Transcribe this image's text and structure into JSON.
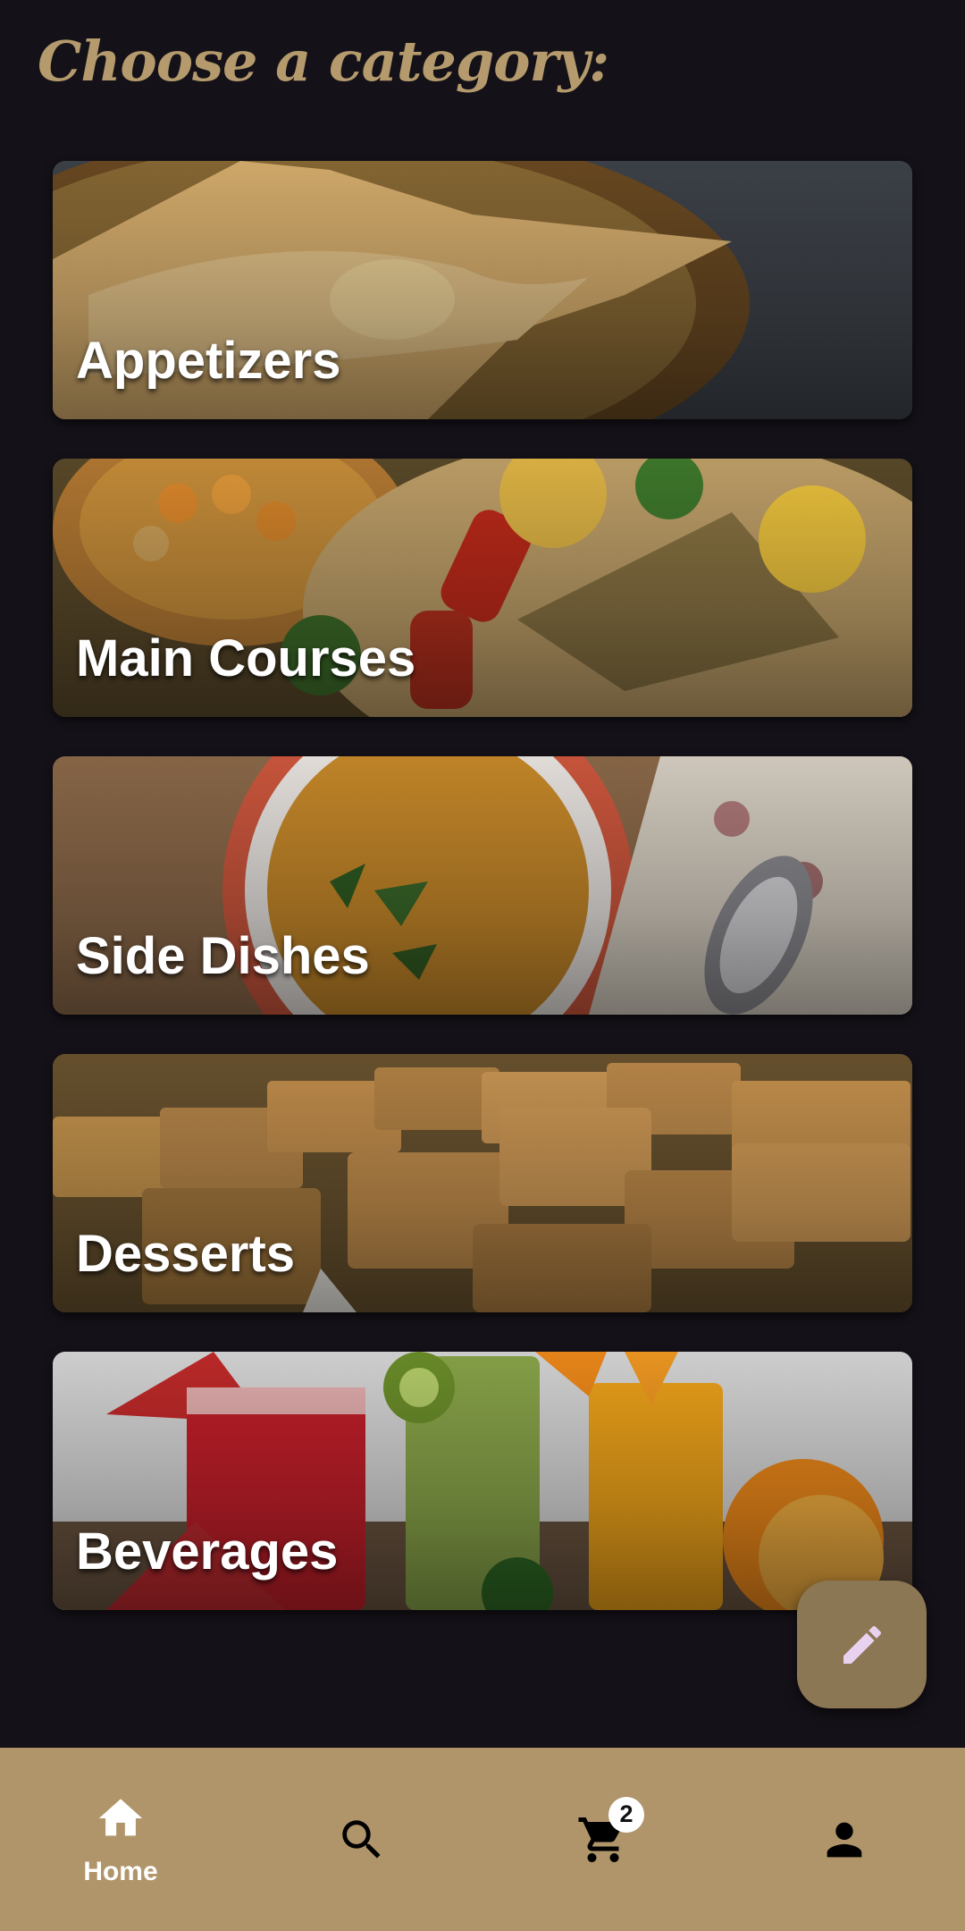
{
  "header": {
    "title": "Choose a category:"
  },
  "categories": [
    {
      "label": "Appetizers"
    },
    {
      "label": "Main Courses"
    },
    {
      "label": "Side Dishes"
    },
    {
      "label": "Desserts"
    },
    {
      "label": "Beverages"
    }
  ],
  "fab": {
    "icon": "pencil-icon"
  },
  "bottom_nav": {
    "items": [
      {
        "icon": "home-icon",
        "label": "Home",
        "active": true
      },
      {
        "icon": "search-icon"
      },
      {
        "icon": "cart-icon",
        "badge": "2"
      },
      {
        "icon": "person-icon"
      }
    ]
  },
  "colors": {
    "background": "#141118",
    "heading": "#b49a6c",
    "nav_bar": "#b0956a",
    "fab": "#8c7755",
    "fab_icon": "#e9d2f0"
  }
}
